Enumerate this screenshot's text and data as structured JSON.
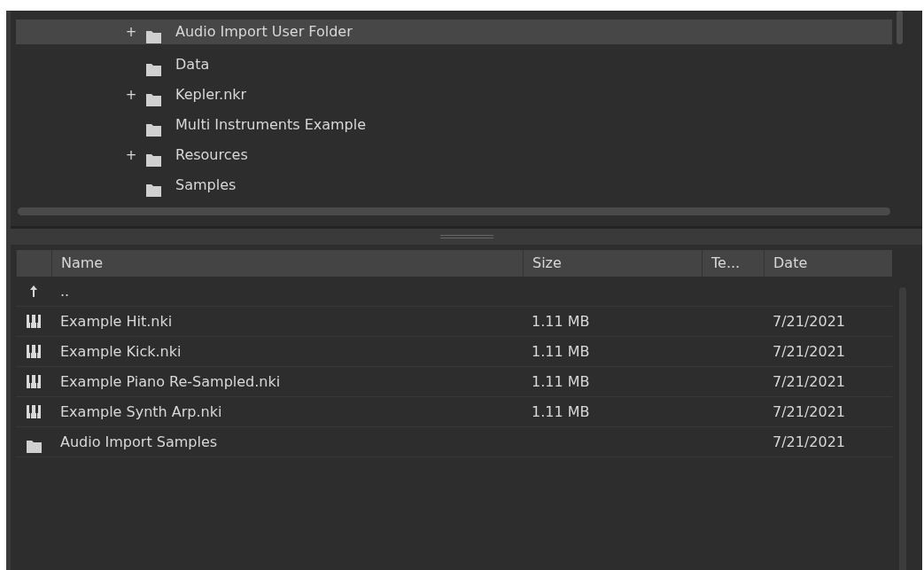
{
  "tree": {
    "items": [
      {
        "label": "Audio Import User Folder",
        "expander": "+",
        "selected": true
      },
      {
        "label": "Data",
        "selected": false
      },
      {
        "label": "Kepler.nkr",
        "expander": "+",
        "selected": false
      },
      {
        "label": "Multi Instruments Example",
        "selected": false
      },
      {
        "label": "Resources",
        "expander": "+",
        "selected": false
      },
      {
        "label": "Samples",
        "selected": false
      }
    ]
  },
  "table": {
    "columns": [
      "Name",
      "Size",
      "Te...",
      "Date"
    ],
    "rows": [
      {
        "kind": "parent",
        "name": ".."
      },
      {
        "kind": "instrument",
        "name": "Example Hit.nki",
        "size": "1.11 MB",
        "date": "7/21/2021"
      },
      {
        "kind": "instrument",
        "name": "Example Kick.nki",
        "size": "1.11 MB",
        "date": "7/21/2021"
      },
      {
        "kind": "instrument",
        "name": "Example Piano Re-Sampled.nki",
        "size": "1.11 MB",
        "date": "7/21/2021"
      },
      {
        "kind": "instrument",
        "name": "Example Synth Arp.nki",
        "size": "1.11 MB",
        "date": "7/21/2021"
      },
      {
        "kind": "folder",
        "name": "Audio Import Samples",
        "date": "7/21/2021"
      }
    ]
  }
}
